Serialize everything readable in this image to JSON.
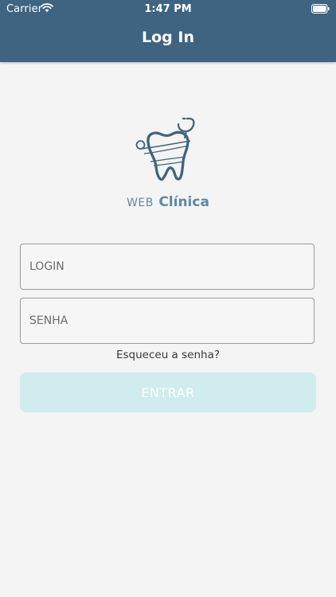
{
  "status_bar": {
    "carrier": "Carrier",
    "time": "1:47 PM"
  },
  "header": {
    "title": "Log In"
  },
  "logo": {
    "brand_prefix": "WEB",
    "brand_name": "Clínica",
    "color": "#3f6481",
    "accent_color": "#5d89a9"
  },
  "form": {
    "login_placeholder": "LOGIN",
    "senha_placeholder": "SENHA",
    "login_value": "",
    "senha_value": "",
    "forgot_password": "Esqueceu a senha?",
    "submit_label": "ENTRAR"
  },
  "colors": {
    "header_bg": "#3f6481",
    "background": "#f4f4f4",
    "button_bg": "#d0ecef",
    "button_text": "#ffffff"
  },
  "icons": [
    "wifi-icon",
    "battery-icon",
    "tooth-logo-icon"
  ]
}
